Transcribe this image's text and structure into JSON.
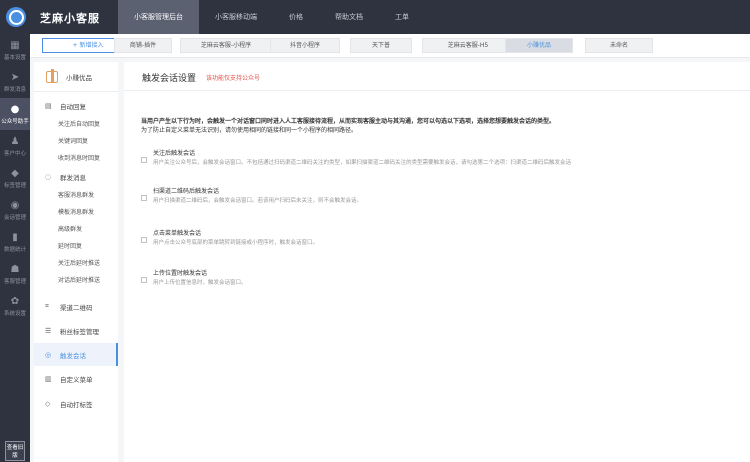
{
  "brand": "芝麻小客服",
  "topnav": [
    "小客服管理后台",
    "小客服移动端",
    "价格",
    "帮助文档",
    "工单"
  ],
  "iconbar": [
    {
      "label": "基本设置",
      "icon": "grid-icon"
    },
    {
      "label": "群发消息",
      "icon": "send-icon"
    },
    {
      "label": "公众号助手",
      "icon": "wechat-icon"
    },
    {
      "label": "客户中心",
      "icon": "users-icon"
    },
    {
      "label": "标签管理",
      "icon": "tag-icon"
    },
    {
      "label": "会话管理",
      "icon": "chat-icon"
    },
    {
      "label": "数据统计",
      "icon": "stats-icon"
    },
    {
      "label": "客服管理",
      "icon": "robot-icon"
    },
    {
      "label": "系统设置",
      "icon": "gear-icon"
    }
  ],
  "old_version": "查看旧版",
  "tabstrip": {
    "add_label": "+ 新增接入",
    "tabs": [
      "商铺-插件",
      "芝麻云客服-小程序",
      "抖音小程序",
      "天下普",
      "芝麻云客服-H5",
      "小赚优品",
      "未命名"
    ]
  },
  "subnav": {
    "account": "小赚优品",
    "groups": [
      {
        "label": "自动回复",
        "icon": "reply-icon",
        "items": [
          "关注后自动回复",
          "关键词回复",
          "收到消息时回复"
        ]
      },
      {
        "label": "群发消息",
        "icon": "megaphone-icon",
        "items": [
          "客服消息群发",
          "模板消息群发",
          "高级群发",
          "延时回复",
          "关注后延时推送",
          "对话后延时推送"
        ]
      },
      {
        "label": "渠道二维码",
        "icon": "qrcode-icon",
        "items": []
      },
      {
        "label": "粉丝标签管理",
        "icon": "list-icon",
        "items": []
      },
      {
        "label": "触发会话",
        "icon": "trigger-icon",
        "items": []
      },
      {
        "label": "自定义菜单",
        "icon": "menu-icon",
        "items": []
      },
      {
        "label": "自动打标签",
        "icon": "tag-icon",
        "items": []
      }
    ]
  },
  "main": {
    "title": "触发会话设置",
    "subtitle": "该功能仅支持公众号",
    "intro1": "当用户产生以下行为时，会触发一个对话窗口同时进入人工客服接待流程，从而实现客服主动与其沟通，您可以勾选以下选项，选择您想要触发会话的类型。",
    "intro2": "为了防止自定义菜单无法识别，请勿使用相同的链接和同一个小程序的相同路径。",
    "options": [
      {
        "title": "关注后触发会话",
        "desc": "用户关注公众号后，会触发会话窗口。不包括通过扫码渠道二维码关注的类型，如果扫描渠道二维码关注的类型需要触发会话，请勾选第二个选项：扫渠道二维码后触发会话"
      },
      {
        "title": "扫渠道二维码后触发会话",
        "desc": "用户扫描渠道二维码后，会触发会话窗口。若该用户扫码后未关注，则不会触发会话。"
      },
      {
        "title": "点击菜单触发会话",
        "desc": "用户点击公众号底部的菜单跳转到链接或小程序时，触发会话窗口。"
      },
      {
        "title": "上传位置时触发会话",
        "desc": "用户上传位置信息时，触发会话窗口。"
      }
    ]
  }
}
